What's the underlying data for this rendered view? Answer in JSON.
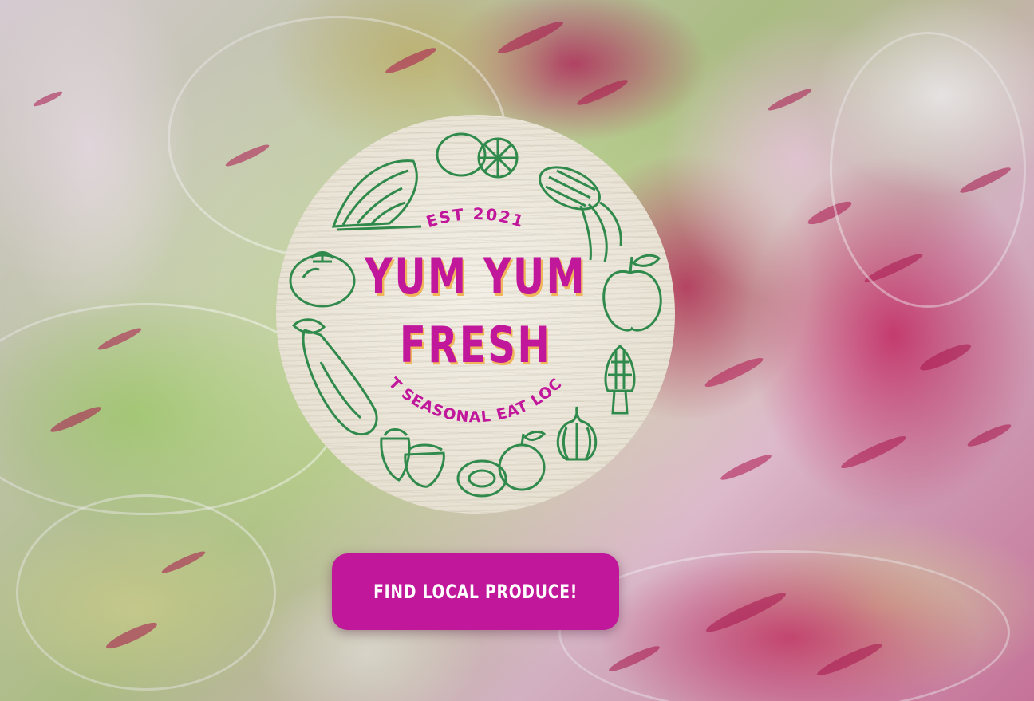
{
  "logo": {
    "est": "EST 2021",
    "title_line1": "YUM YUM",
    "title_line2": "FRESH",
    "tagline": "EAT SEASONAL EAT LOCAL",
    "icons": [
      "lettuce-icon",
      "lemon-icon",
      "corn-icon",
      "tomato-icon",
      "apple-icon",
      "eggplant-icon",
      "morel-mushroom-icon",
      "garlic-icon",
      "strawberry-icon",
      "guava-icon"
    ]
  },
  "cta": {
    "label": "FIND LOCAL PRODUCE!"
  },
  "colors": {
    "brand_magenta": "#c0179b",
    "title_shadow": "#f0b45a",
    "illustration_green": "#2f8a4c",
    "logo_background": "#ece6d9"
  }
}
